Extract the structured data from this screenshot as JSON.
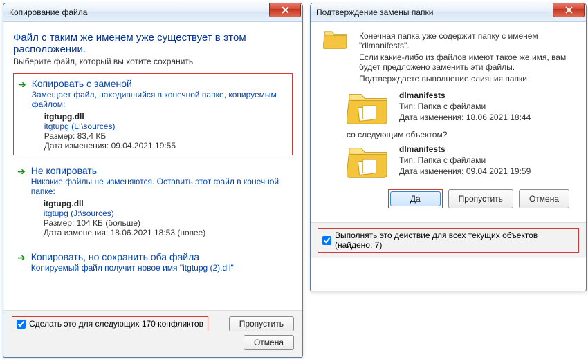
{
  "left": {
    "title": "Копирование файла",
    "headline": "Файл с таким же именем уже существует в этом расположении.",
    "sub": "Выберите файл, который вы хотите сохранить",
    "opt1": {
      "title": "Копировать с заменой",
      "desc": "Замещает файл, находившийся в конечной папке, копируемым файлом:",
      "fname": "itgtupg.dll",
      "fpath": "itgtupg (L:\\sources)",
      "size": "Размер: 83,4 КБ",
      "date": "Дата изменения: 09.04.2021 19:55"
    },
    "opt2": {
      "title": "Не копировать",
      "desc": "Никакие файлы не изменяются. Оставить этот файл в конечной папке:",
      "fname": "itgtupg.dll",
      "fpath": "itgtupg (J:\\sources)",
      "size": "Размер: 104 КБ (больше)",
      "date": "Дата изменения: 18.06.2021 18:53 (новее)"
    },
    "opt3": {
      "title": "Копировать, но сохранить оба файла",
      "desc": "Копируемый файл получит новое имя \"itgtupg (2).dll\""
    },
    "footer_chk": "Сделать это для следующих 170 конфликтов",
    "skip": "Пропустить",
    "cancel": "Отмена"
  },
  "right": {
    "title": "Подтверждение замены папки",
    "p1": "Конечная папка уже содержит папку с именем \"dlmanifests\".",
    "p2": "Если какие-либо из файлов имеют такое же имя, вам будет предложено заменить эти файлы.",
    "p3": "Подтверждаете выполнение слияния папки",
    "folderA": {
      "name": "dlmanifests",
      "type": "Тип: Папка с файлами",
      "date": "Дата изменения: 18.06.2021 18:44"
    },
    "p4": "со следующим объектом?",
    "folderB": {
      "name": "dlmanifests",
      "type": "Тип: Папка с файлами",
      "date": "Дата изменения: 09.04.2021 19:59"
    },
    "yes": "Да",
    "skip": "Пропустить",
    "cancel": "Отмена",
    "footer_chk": "Выполнять это действие для всех текущих объектов (найдено: 7)"
  }
}
